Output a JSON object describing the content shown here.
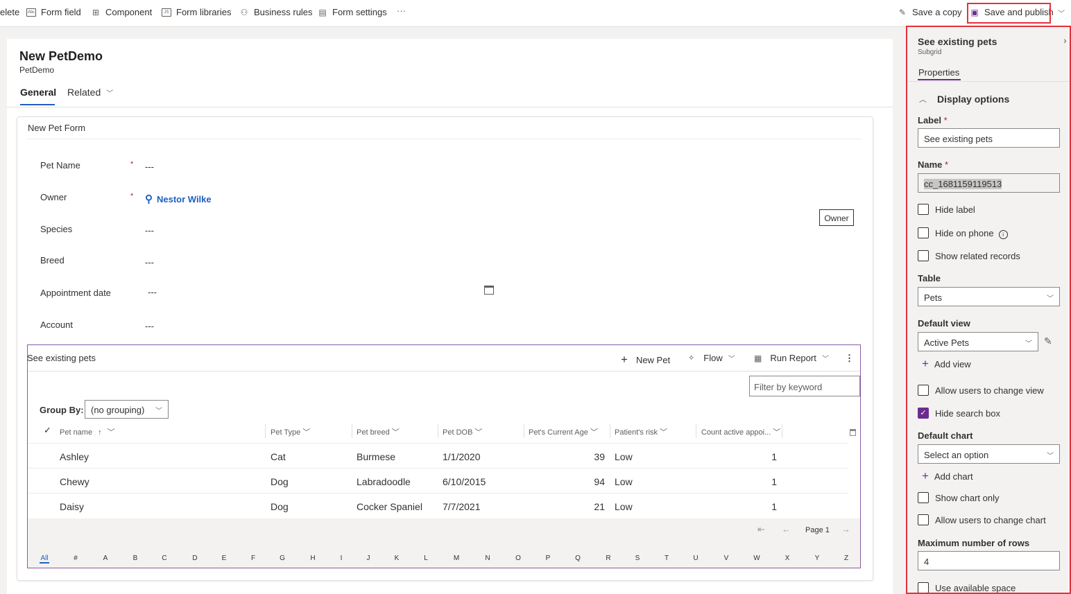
{
  "commandbar": {
    "items": [
      {
        "label": "elete",
        "icon": "delete-icon"
      },
      {
        "label": "Form field",
        "icon": "form-field-icon"
      },
      {
        "label": "Component",
        "icon": "component-icon"
      },
      {
        "label": "Form libraries",
        "icon": "form-libraries-icon"
      },
      {
        "label": "Business rules",
        "icon": "business-rules-icon"
      },
      {
        "label": "Form settings",
        "icon": "form-settings-icon"
      }
    ],
    "more": "···",
    "save_copy": "Save a copy",
    "save_publish": "Save and publish"
  },
  "form": {
    "title": "New PetDemo",
    "subtitle": "PetDemo",
    "tabs": {
      "general": "General",
      "related": "Related"
    },
    "section_title": "New Pet Form",
    "fields": {
      "pet_name": {
        "label": "Pet Name",
        "value": "---"
      },
      "owner": {
        "label": "Owner",
        "value": "Nestor Wilke"
      },
      "species": {
        "label": "Species",
        "value": "---"
      },
      "breed": {
        "label": "Breed",
        "value": "---"
      },
      "appointment_date": {
        "label": "Appointment date",
        "value": "---"
      },
      "account": {
        "label": "Account",
        "value": "---"
      }
    },
    "required_marker": "*",
    "tooltip": "Owner"
  },
  "subgrid": {
    "title": "See existing pets",
    "commands": {
      "new": "New Pet",
      "flow": "Flow",
      "report": "Run Report"
    },
    "filter_placeholder": "Filter by keyword",
    "group_by_label": "Group By:",
    "group_by_value": "(no grouping)",
    "columns": [
      "Pet name",
      "Pet Type",
      "Pet breed",
      "Pet DOB",
      "Pet's Current Age",
      "Patient's risk",
      "Count active appoi..."
    ],
    "rows": [
      [
        "Ashley",
        "Cat",
        "Burmese",
        "1/1/2020",
        "39",
        "Low",
        "1"
      ],
      [
        "Chewy",
        "Dog",
        "Labradoodle",
        "6/10/2015",
        "94",
        "Low",
        "1"
      ],
      [
        "Daisy",
        "Dog",
        "Cocker Spaniel",
        "7/7/2021",
        "21",
        "Low",
        "1"
      ]
    ],
    "page_label": "Page 1",
    "letters": [
      "All",
      "#",
      "A",
      "B",
      "C",
      "D",
      "E",
      "F",
      "G",
      "H",
      "I",
      "J",
      "K",
      "L",
      "M",
      "N",
      "O",
      "P",
      "Q",
      "R",
      "S",
      "T",
      "U",
      "V",
      "W",
      "X",
      "Y",
      "Z"
    ]
  },
  "panel": {
    "title": "See existing pets",
    "subtitle": "Subgrid",
    "tab": "Properties",
    "section": "Display options",
    "label_label": "Label",
    "label_value": "See existing pets",
    "name_label": "Name",
    "name_value": "cc_1681159119513",
    "hide_label": "Hide label",
    "hide_on_phone": "Hide on phone",
    "show_related": "Show related records",
    "table_label": "Table",
    "table_value": "Pets",
    "default_view_label": "Default view",
    "default_view_value": "Active Pets",
    "add_view": "Add view",
    "allow_change_view": "Allow users to change view",
    "hide_search": "Hide search box",
    "default_chart_label": "Default chart",
    "default_chart_value": "Select an option",
    "add_chart": "Add chart",
    "show_chart_only": "Show chart only",
    "allow_change_chart": "Allow users to change chart",
    "max_rows_label": "Maximum number of rows",
    "max_rows_value": "4",
    "use_space": "Use available space"
  }
}
